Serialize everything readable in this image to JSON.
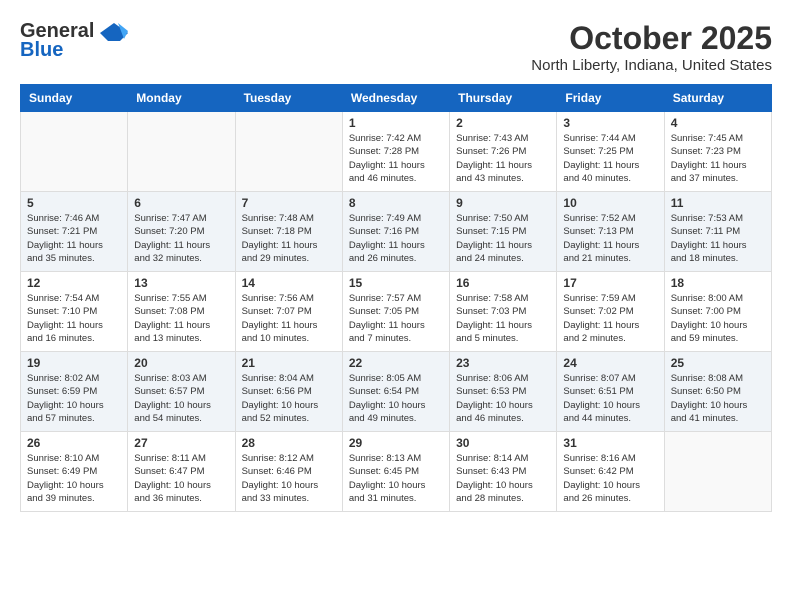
{
  "header": {
    "logo_general": "General",
    "logo_blue": "Blue",
    "month": "October 2025",
    "location": "North Liberty, Indiana, United States"
  },
  "weekdays": [
    "Sunday",
    "Monday",
    "Tuesday",
    "Wednesday",
    "Thursday",
    "Friday",
    "Saturday"
  ],
  "weeks": [
    [
      {
        "day": "",
        "info": ""
      },
      {
        "day": "",
        "info": ""
      },
      {
        "day": "",
        "info": ""
      },
      {
        "day": "1",
        "info": "Sunrise: 7:42 AM\nSunset: 7:28 PM\nDaylight: 11 hours and 46 minutes."
      },
      {
        "day": "2",
        "info": "Sunrise: 7:43 AM\nSunset: 7:26 PM\nDaylight: 11 hours and 43 minutes."
      },
      {
        "day": "3",
        "info": "Sunrise: 7:44 AM\nSunset: 7:25 PM\nDaylight: 11 hours and 40 minutes."
      },
      {
        "day": "4",
        "info": "Sunrise: 7:45 AM\nSunset: 7:23 PM\nDaylight: 11 hours and 37 minutes."
      }
    ],
    [
      {
        "day": "5",
        "info": "Sunrise: 7:46 AM\nSunset: 7:21 PM\nDaylight: 11 hours and 35 minutes."
      },
      {
        "day": "6",
        "info": "Sunrise: 7:47 AM\nSunset: 7:20 PM\nDaylight: 11 hours and 32 minutes."
      },
      {
        "day": "7",
        "info": "Sunrise: 7:48 AM\nSunset: 7:18 PM\nDaylight: 11 hours and 29 minutes."
      },
      {
        "day": "8",
        "info": "Sunrise: 7:49 AM\nSunset: 7:16 PM\nDaylight: 11 hours and 26 minutes."
      },
      {
        "day": "9",
        "info": "Sunrise: 7:50 AM\nSunset: 7:15 PM\nDaylight: 11 hours and 24 minutes."
      },
      {
        "day": "10",
        "info": "Sunrise: 7:52 AM\nSunset: 7:13 PM\nDaylight: 11 hours and 21 minutes."
      },
      {
        "day": "11",
        "info": "Sunrise: 7:53 AM\nSunset: 7:11 PM\nDaylight: 11 hours and 18 minutes."
      }
    ],
    [
      {
        "day": "12",
        "info": "Sunrise: 7:54 AM\nSunset: 7:10 PM\nDaylight: 11 hours and 16 minutes."
      },
      {
        "day": "13",
        "info": "Sunrise: 7:55 AM\nSunset: 7:08 PM\nDaylight: 11 hours and 13 minutes."
      },
      {
        "day": "14",
        "info": "Sunrise: 7:56 AM\nSunset: 7:07 PM\nDaylight: 11 hours and 10 minutes."
      },
      {
        "day": "15",
        "info": "Sunrise: 7:57 AM\nSunset: 7:05 PM\nDaylight: 11 hours and 7 minutes."
      },
      {
        "day": "16",
        "info": "Sunrise: 7:58 AM\nSunset: 7:03 PM\nDaylight: 11 hours and 5 minutes."
      },
      {
        "day": "17",
        "info": "Sunrise: 7:59 AM\nSunset: 7:02 PM\nDaylight: 11 hours and 2 minutes."
      },
      {
        "day": "18",
        "info": "Sunrise: 8:00 AM\nSunset: 7:00 PM\nDaylight: 10 hours and 59 minutes."
      }
    ],
    [
      {
        "day": "19",
        "info": "Sunrise: 8:02 AM\nSunset: 6:59 PM\nDaylight: 10 hours and 57 minutes."
      },
      {
        "day": "20",
        "info": "Sunrise: 8:03 AM\nSunset: 6:57 PM\nDaylight: 10 hours and 54 minutes."
      },
      {
        "day": "21",
        "info": "Sunrise: 8:04 AM\nSunset: 6:56 PM\nDaylight: 10 hours and 52 minutes."
      },
      {
        "day": "22",
        "info": "Sunrise: 8:05 AM\nSunset: 6:54 PM\nDaylight: 10 hours and 49 minutes."
      },
      {
        "day": "23",
        "info": "Sunrise: 8:06 AM\nSunset: 6:53 PM\nDaylight: 10 hours and 46 minutes."
      },
      {
        "day": "24",
        "info": "Sunrise: 8:07 AM\nSunset: 6:51 PM\nDaylight: 10 hours and 44 minutes."
      },
      {
        "day": "25",
        "info": "Sunrise: 8:08 AM\nSunset: 6:50 PM\nDaylight: 10 hours and 41 minutes."
      }
    ],
    [
      {
        "day": "26",
        "info": "Sunrise: 8:10 AM\nSunset: 6:49 PM\nDaylight: 10 hours and 39 minutes."
      },
      {
        "day": "27",
        "info": "Sunrise: 8:11 AM\nSunset: 6:47 PM\nDaylight: 10 hours and 36 minutes."
      },
      {
        "day": "28",
        "info": "Sunrise: 8:12 AM\nSunset: 6:46 PM\nDaylight: 10 hours and 33 minutes."
      },
      {
        "day": "29",
        "info": "Sunrise: 8:13 AM\nSunset: 6:45 PM\nDaylight: 10 hours and 31 minutes."
      },
      {
        "day": "30",
        "info": "Sunrise: 8:14 AM\nSunset: 6:43 PM\nDaylight: 10 hours and 28 minutes."
      },
      {
        "day": "31",
        "info": "Sunrise: 8:16 AM\nSunset: 6:42 PM\nDaylight: 10 hours and 26 minutes."
      },
      {
        "day": "",
        "info": ""
      }
    ]
  ]
}
